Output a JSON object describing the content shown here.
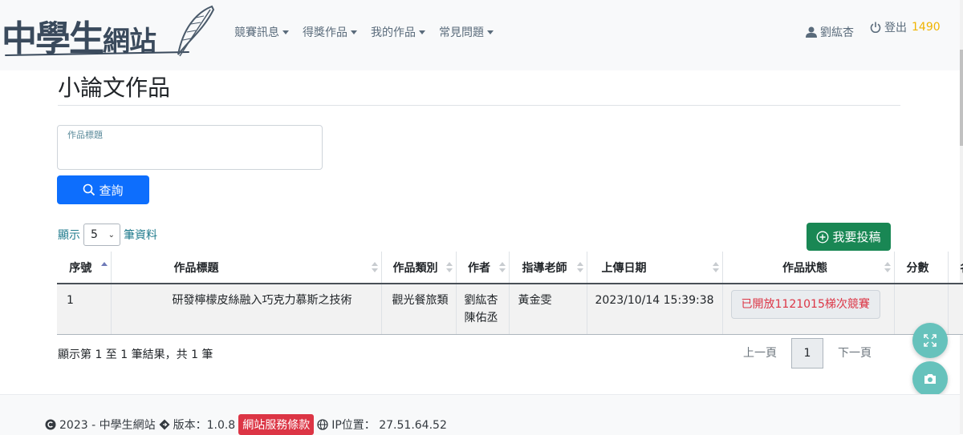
{
  "brand": {
    "part1": "中學生",
    "part2": "網站"
  },
  "nav": {
    "items": [
      {
        "label": "競賽訊息"
      },
      {
        "label": "得獎作品"
      },
      {
        "label": "我的作品"
      },
      {
        "label": "常見問題"
      }
    ],
    "user_name": "劉紘杏",
    "logout_label": "登出",
    "points": "1490"
  },
  "page": {
    "title": "小論文作品"
  },
  "search": {
    "label": "作品標題",
    "value": "",
    "button": "查詢"
  },
  "length": {
    "prefix": "顯示",
    "value": "5",
    "suffix": "筆資料"
  },
  "submit_button": "我要投稿",
  "table": {
    "headers": [
      "序號",
      "作品標題",
      "作品類別",
      "作者",
      "指導老師",
      "上傳日期",
      "作品狀態",
      "分數",
      "名次"
    ],
    "rows": [
      {
        "no": "1",
        "title": "研發檸檬皮絲融入巧克力慕斯之技術",
        "category": "觀光餐旅類",
        "author1": "劉紘杏",
        "author2": "陳佑丞",
        "teacher": "黃金雯",
        "date": "2023/10/14 15:39:38",
        "status": "已開放1121015梯次競賽",
        "score": "",
        "rank": ""
      }
    ]
  },
  "info": "顯示第 1 至 1 筆結果，共 1 筆",
  "pager": {
    "prev": "上一頁",
    "current": "1",
    "next": "下一頁"
  },
  "footer": {
    "copyright": "2023 - 中學生網站",
    "version": "版本：1.0.8",
    "terms": "網站服務條款",
    "ip": "IP位置： 27.51.64.52"
  },
  "colors": {
    "primary": "#0d6efd",
    "success": "#198754",
    "danger": "#dc3545",
    "points": "#f0b400",
    "fab": "#66c2bc"
  },
  "icons": [
    "user-icon",
    "power-icon",
    "search-icon",
    "plus-circle-icon",
    "expand-icon",
    "camera-icon",
    "copyright-icon",
    "diamond-icon",
    "globe-icon",
    "feather-icon"
  ]
}
